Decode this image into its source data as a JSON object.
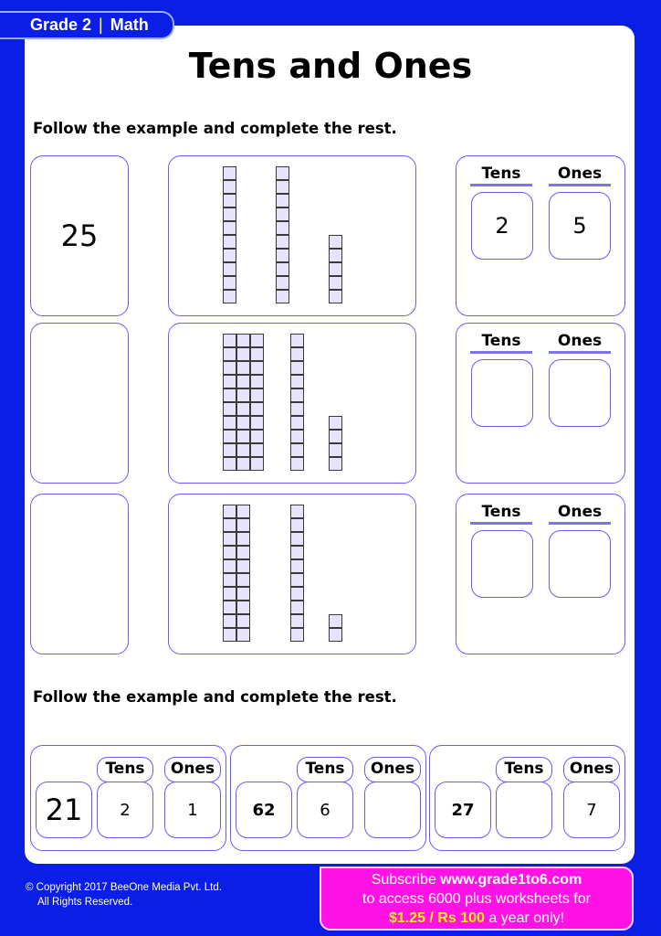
{
  "header": {
    "grade": "Grade 2",
    "separator": "|",
    "subject": "Math",
    "title": "Tens and Ones"
  },
  "section1": {
    "instruction": "Follow the example and complete the rest.",
    "rows": [
      {
        "number": "25",
        "tens_rods": 2,
        "ones_cubes": 5,
        "tens_label": "Tens",
        "ones_label": "Ones",
        "tens_answer": "2",
        "ones_answer": "5"
      },
      {
        "number": "",
        "tens_rods": 4,
        "ones_cubes": 4,
        "tens_label": "Tens",
        "ones_label": "Ones",
        "tens_answer": "",
        "ones_answer": ""
      },
      {
        "number": "",
        "tens_rods": 3,
        "ones_cubes": 2,
        "tens_label": "Tens",
        "ones_label": "Ones",
        "tens_answer": "",
        "ones_answer": ""
      }
    ]
  },
  "section2": {
    "instruction": "Follow the example and complete the rest.",
    "items": [
      {
        "number": "21",
        "tens_label": "Tens",
        "ones_label": "Ones",
        "tens": "2",
        "ones": "1"
      },
      {
        "number": "62",
        "tens_label": "Tens",
        "ones_label": "Ones",
        "tens": "6",
        "ones": ""
      },
      {
        "number": "27",
        "tens_label": "Tens",
        "ones_label": "Ones",
        "tens": "",
        "ones": "7"
      }
    ]
  },
  "footer": {
    "copyright_line1": "© Copyright 2017 BeeOne Media Pvt. Ltd.",
    "copyright_line2": "All Rights Reserved.",
    "promo_subscribe": "Subscribe ",
    "promo_url": "www.grade1to6.com",
    "promo_line2": "to access 6000 plus worksheets for",
    "promo_price": "$1.25 / Rs 100",
    "promo_tail": " a year only!"
  },
  "colors": {
    "background": "#0a1ee6",
    "box_border": "#6a5cf0",
    "block_fill": "#e6e4fb",
    "promo_bg": "#ff12e6",
    "promo_price": "#fff200"
  }
}
